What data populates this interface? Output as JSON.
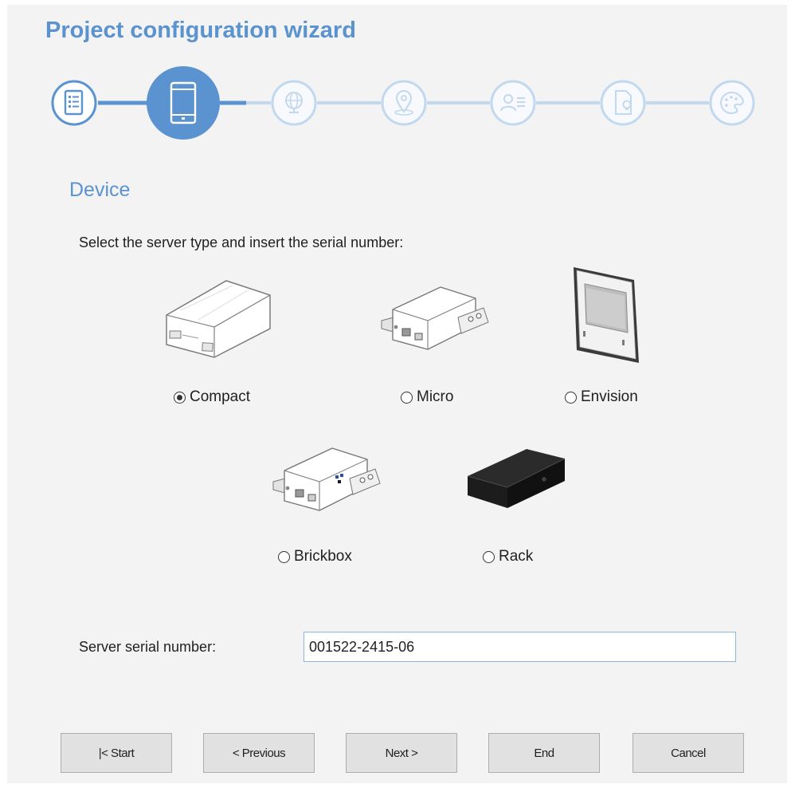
{
  "title": "Project configuration wizard",
  "steps": [
    {
      "icon": "document-list-icon",
      "state": "completed"
    },
    {
      "icon": "tablet-icon",
      "state": "current"
    },
    {
      "icon": "globe-icon",
      "state": "pending"
    },
    {
      "icon": "location-pin-icon",
      "state": "pending"
    },
    {
      "icon": "user-list-icon",
      "state": "pending"
    },
    {
      "icon": "document-lightbulb-icon",
      "state": "pending"
    },
    {
      "icon": "palette-icon",
      "state": "pending"
    }
  ],
  "section_title": "Device",
  "instruction": "Select the server type and insert the serial number:",
  "devices": [
    {
      "label": "Compact",
      "checked": true
    },
    {
      "label": "Micro",
      "checked": false
    },
    {
      "label": "Envision",
      "checked": false
    },
    {
      "label": "Brickbox",
      "checked": false
    },
    {
      "label": "Rack",
      "checked": false
    }
  ],
  "serial": {
    "label": "Server serial number:",
    "value": "001522-2415-06"
  },
  "buttons": {
    "start": "|< Start",
    "previous": "< Previous",
    "next": "Next >",
    "end": "End",
    "cancel": "Cancel"
  },
  "colors": {
    "accent": "#5a93cf",
    "step_pending": "#c2d8ef",
    "window_bg": "#f3f3f3"
  }
}
